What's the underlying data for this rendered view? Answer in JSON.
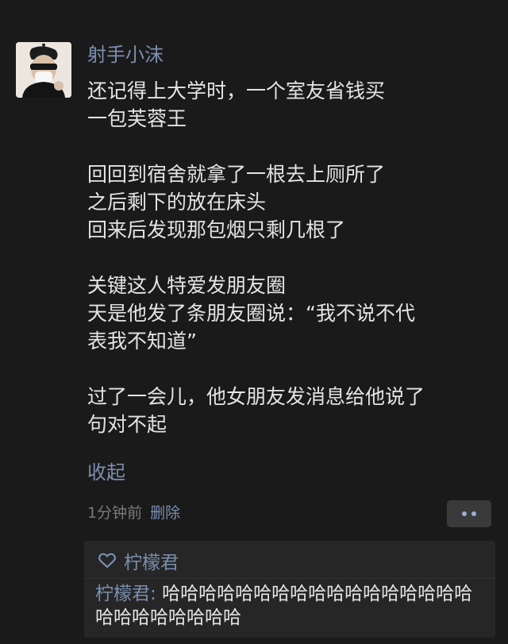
{
  "post": {
    "username": "射手小沫",
    "lines": [
      "还记得上大学时，一个室友省钱买",
      "一包芙蓉王",
      "",
      "回回到宿舍就拿了一根去上厕所了",
      "之后剩下的放在床头",
      "回来后发现那包烟只剩几根了",
      "",
      "关键这人特爱发朋友圈",
      "天是他发了条朋友圈说：“我不说不代",
      "表我不知道”",
      "",
      "过了一会儿，他女朋友发消息给他说了",
      "句对不起"
    ],
    "collapse_label": "收起",
    "time": "1分钟前",
    "delete_label": "删除"
  },
  "likes": {
    "icon": "heart-outline-icon",
    "names": "柠檬君"
  },
  "comments": [
    {
      "author": "柠檬君",
      "separator": ": ",
      "text": "哈哈哈哈哈哈哈哈哈哈哈哈哈哈哈哈哈哈哈哈哈哈哈哈哈"
    }
  ],
  "colors": {
    "background": "#1a1a1a",
    "link_blue": "#7b8fb0",
    "text": "#e4e4e4",
    "meta_gray": "#7a7a7a",
    "panel": "#262626"
  }
}
